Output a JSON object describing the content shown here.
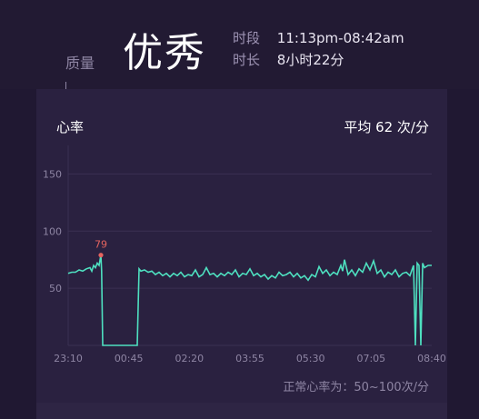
{
  "header": {
    "quality_label": "质量",
    "quality_value": "优秀",
    "period_label": "时段",
    "period_value": "11:13pm-08:42am",
    "duration_label": "时长",
    "duration_value": "8小时22分"
  },
  "card": {
    "title": "心率",
    "average": "平均 62 次/分",
    "normal_range": "正常心率为：50~100次/分"
  },
  "colors": {
    "line": "#4ee0c0",
    "peak": "#e5645f",
    "background": "#221a33"
  },
  "chart_data": {
    "type": "line",
    "title": "心率",
    "ylim": [
      0,
      175
    ],
    "yticks": [
      "150",
      "100",
      "50"
    ],
    "xticks": [
      "23:10",
      "00:45",
      "02:20",
      "03:55",
      "05:30",
      "07:05",
      "08:40"
    ],
    "peak": {
      "label": "79",
      "x": 0.09,
      "value": 79
    },
    "series": [
      {
        "values": [
          [
            0.0,
            63
          ],
          [
            0.01,
            64
          ],
          [
            0.02,
            64
          ],
          [
            0.03,
            66
          ],
          [
            0.04,
            65
          ],
          [
            0.05,
            67
          ],
          [
            0.06,
            68
          ],
          [
            0.065,
            65
          ],
          [
            0.07,
            70
          ],
          [
            0.075,
            68
          ],
          [
            0.08,
            72
          ],
          [
            0.085,
            70
          ],
          [
            0.09,
            79
          ],
          [
            0.092,
            65
          ],
          [
            0.095,
            0
          ],
          [
            0.19,
            0
          ],
          [
            0.195,
            67
          ],
          [
            0.2,
            65
          ],
          [
            0.21,
            66
          ],
          [
            0.22,
            64
          ],
          [
            0.23,
            65
          ],
          [
            0.24,
            62
          ],
          [
            0.25,
            64
          ],
          [
            0.26,
            61
          ],
          [
            0.27,
            63
          ],
          [
            0.28,
            60
          ],
          [
            0.29,
            63
          ],
          [
            0.3,
            61
          ],
          [
            0.31,
            64
          ],
          [
            0.32,
            60
          ],
          [
            0.33,
            62
          ],
          [
            0.34,
            61
          ],
          [
            0.35,
            66
          ],
          [
            0.36,
            60
          ],
          [
            0.37,
            62
          ],
          [
            0.38,
            68
          ],
          [
            0.39,
            62
          ],
          [
            0.4,
            63
          ],
          [
            0.41,
            60
          ],
          [
            0.42,
            63
          ],
          [
            0.43,
            61
          ],
          [
            0.44,
            64
          ],
          [
            0.45,
            62
          ],
          [
            0.46,
            66
          ],
          [
            0.47,
            60
          ],
          [
            0.48,
            63
          ],
          [
            0.49,
            62
          ],
          [
            0.5,
            67
          ],
          [
            0.51,
            61
          ],
          [
            0.52,
            63
          ],
          [
            0.53,
            60
          ],
          [
            0.54,
            62
          ],
          [
            0.55,
            58
          ],
          [
            0.56,
            61
          ],
          [
            0.57,
            59
          ],
          [
            0.58,
            64
          ],
          [
            0.59,
            61
          ],
          [
            0.6,
            62
          ],
          [
            0.61,
            64
          ],
          [
            0.62,
            60
          ],
          [
            0.63,
            63
          ],
          [
            0.64,
            59
          ],
          [
            0.65,
            61
          ],
          [
            0.66,
            57
          ],
          [
            0.67,
            62
          ],
          [
            0.68,
            60
          ],
          [
            0.69,
            69
          ],
          [
            0.7,
            63
          ],
          [
            0.71,
            66
          ],
          [
            0.72,
            61
          ],
          [
            0.73,
            64
          ],
          [
            0.74,
            62
          ],
          [
            0.75,
            70
          ],
          [
            0.755,
            65
          ],
          [
            0.76,
            75
          ],
          [
            0.77,
            62
          ],
          [
            0.78,
            66
          ],
          [
            0.79,
            61
          ],
          [
            0.8,
            67
          ],
          [
            0.81,
            64
          ],
          [
            0.82,
            72
          ],
          [
            0.83,
            66
          ],
          [
            0.84,
            74
          ],
          [
            0.85,
            63
          ],
          [
            0.86,
            66
          ],
          [
            0.87,
            60
          ],
          [
            0.88,
            64
          ],
          [
            0.89,
            62
          ],
          [
            0.9,
            66
          ],
          [
            0.91,
            60
          ],
          [
            0.92,
            63
          ],
          [
            0.93,
            64
          ],
          [
            0.94,
            61
          ],
          [
            0.95,
            70
          ],
          [
            0.955,
            0
          ],
          [
            0.96,
            72
          ],
          [
            0.965,
            70
          ],
          [
            0.97,
            0
          ],
          [
            0.975,
            72
          ],
          [
            0.98,
            68
          ],
          [
            0.99,
            70
          ],
          [
            1.0,
            70
          ]
        ]
      }
    ]
  }
}
